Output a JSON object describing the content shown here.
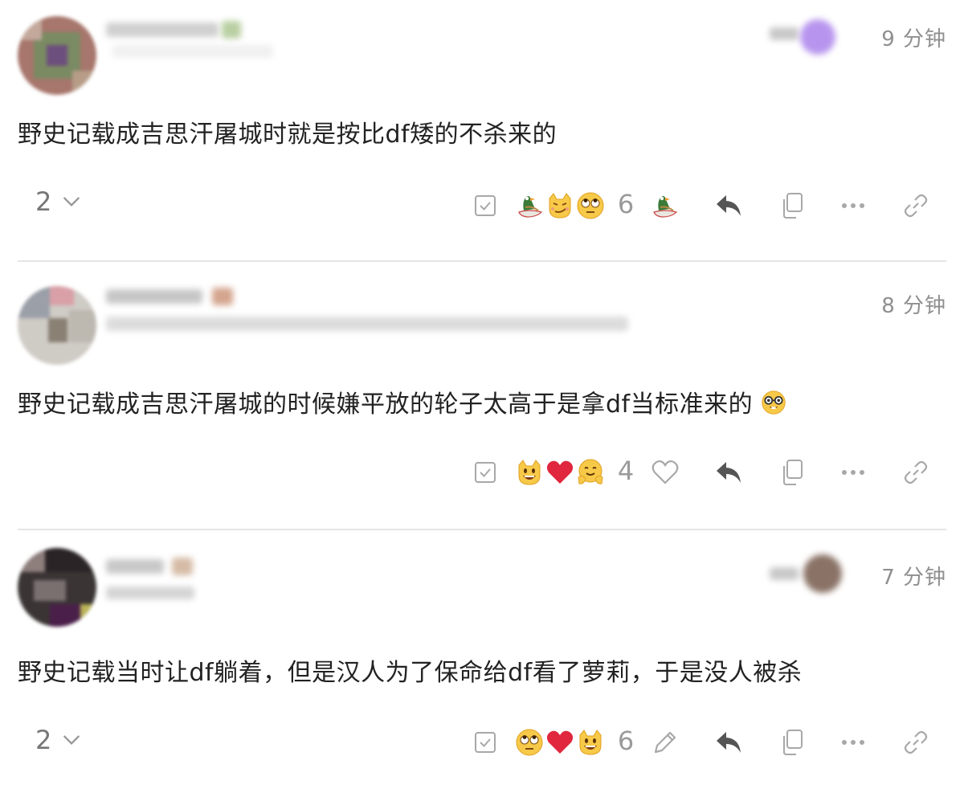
{
  "posts": [
    {
      "time": "9 分钟",
      "text": "野史记载成吉思汗屠城时就是按比df矮的不杀来的",
      "reply_count": "2",
      "reaction_count": "6"
    },
    {
      "time": "8 分钟",
      "text": "野史记载成吉思汗屠城的时候嫌平放的轮子太高于是拿df当标准来的",
      "reaction_count": "4"
    },
    {
      "time": "7 分钟",
      "text": "野史记载当时让df躺着，但是汉人为了保命给df看了萝莉，于是没人被杀",
      "reply_count": "2",
      "reaction_count": "6"
    }
  ],
  "icons": {
    "select": "checkbox-icon",
    "reply": "reply-arrow-icon",
    "copy": "copy-icon",
    "more": "more-dots-icon",
    "link": "link-icon",
    "like": "heart-outline-icon",
    "edit": "pencil-icon",
    "expand": "chevron-down-icon"
  },
  "colors": {
    "text": "#222222",
    "muted": "#8f8f8f",
    "icon": "#9a9a9a",
    "reply_icon": "#555555",
    "divider": "#e5e5e5",
    "heart": "#e0273e",
    "emoji_yellow": "#f7c948"
  }
}
